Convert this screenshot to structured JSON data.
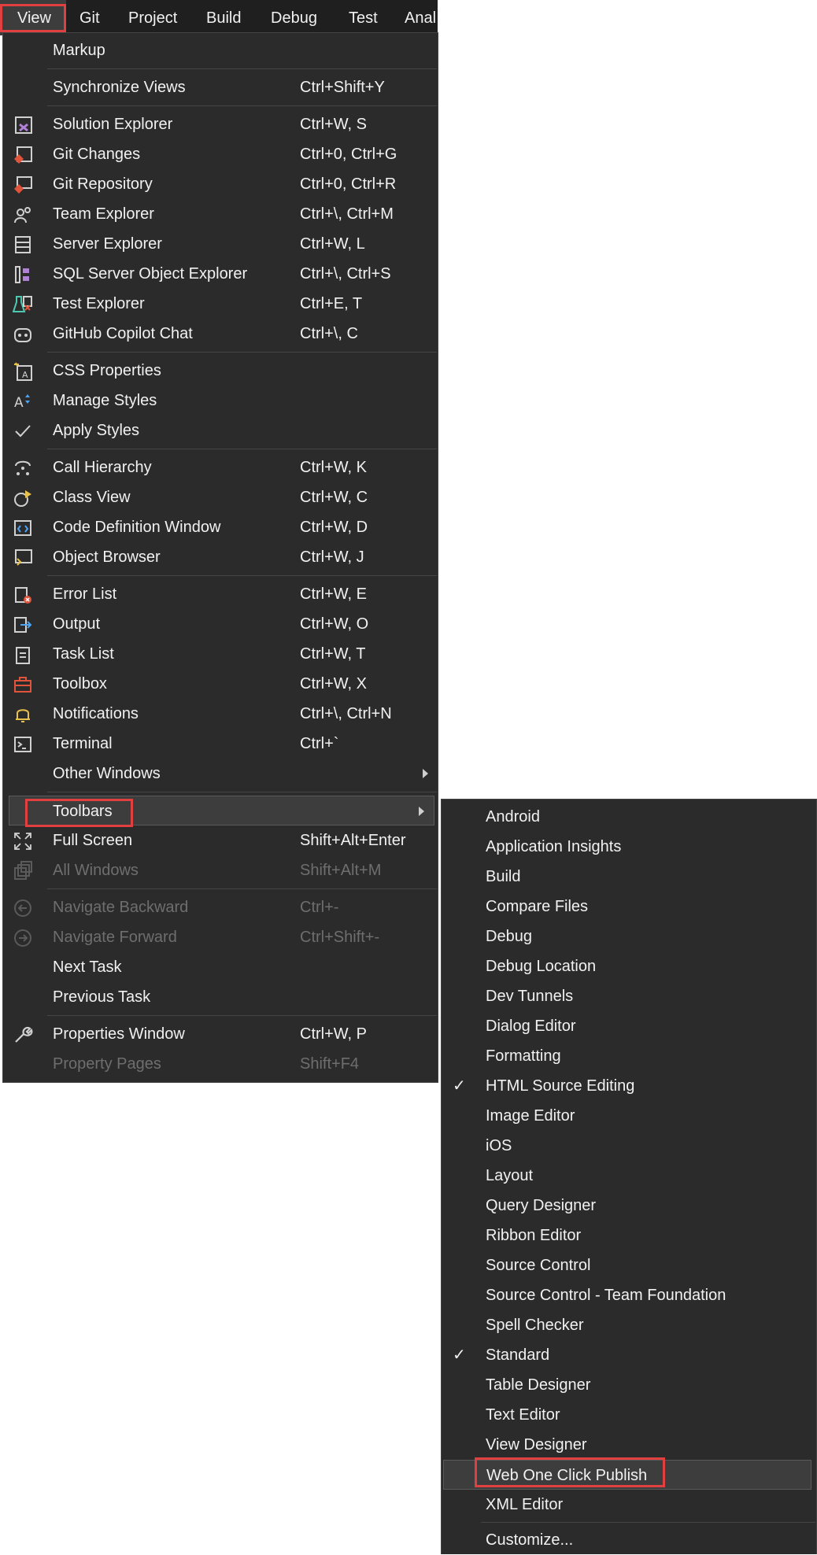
{
  "menubar": {
    "items": [
      {
        "label": "View"
      },
      {
        "label": "Git"
      },
      {
        "label": "Project"
      },
      {
        "label": "Build"
      },
      {
        "label": "Debug"
      },
      {
        "label": "Test"
      },
      {
        "label": "Anal"
      }
    ]
  },
  "view_menu": {
    "items": [
      {
        "label": "Markup",
        "shortcut": "",
        "icon": "none"
      },
      {
        "label": "Synchronize Views",
        "shortcut": "Ctrl+Shift+Y",
        "icon": "none"
      },
      {
        "label": "Solution Explorer",
        "shortcut": "Ctrl+W, S",
        "icon": "solution-explorer-icon"
      },
      {
        "label": "Git Changes",
        "shortcut": "Ctrl+0, Ctrl+G",
        "icon": "git-changes-icon"
      },
      {
        "label": "Git Repository",
        "shortcut": "Ctrl+0, Ctrl+R",
        "icon": "git-repository-icon"
      },
      {
        "label": "Team Explorer",
        "shortcut": "Ctrl+\\, Ctrl+M",
        "icon": "team-explorer-icon"
      },
      {
        "label": "Server Explorer",
        "shortcut": "Ctrl+W, L",
        "icon": "server-explorer-icon"
      },
      {
        "label": "SQL Server Object Explorer",
        "shortcut": "Ctrl+\\, Ctrl+S",
        "icon": "sql-server-icon"
      },
      {
        "label": "Test Explorer",
        "shortcut": "Ctrl+E, T",
        "icon": "test-explorer-icon"
      },
      {
        "label": "GitHub Copilot Chat",
        "shortcut": "Ctrl+\\, C",
        "icon": "copilot-icon"
      },
      {
        "label": "CSS Properties",
        "shortcut": "",
        "icon": "css-properties-icon"
      },
      {
        "label": "Manage Styles",
        "shortcut": "",
        "icon": "manage-styles-icon"
      },
      {
        "label": "Apply Styles",
        "shortcut": "",
        "icon": "checkmark-icon"
      },
      {
        "label": "Call Hierarchy",
        "shortcut": "Ctrl+W, K",
        "icon": "call-hierarchy-icon"
      },
      {
        "label": "Class View",
        "shortcut": "Ctrl+W, C",
        "icon": "class-view-icon"
      },
      {
        "label": "Code Definition Window",
        "shortcut": "Ctrl+W, D",
        "icon": "code-definition-icon"
      },
      {
        "label": "Object Browser",
        "shortcut": "Ctrl+W, J",
        "icon": "object-browser-icon"
      },
      {
        "label": "Error List",
        "shortcut": "Ctrl+W, E",
        "icon": "error-list-icon"
      },
      {
        "label": "Output",
        "shortcut": "Ctrl+W, O",
        "icon": "output-icon"
      },
      {
        "label": "Task List",
        "shortcut": "Ctrl+W, T",
        "icon": "task-list-icon"
      },
      {
        "label": "Toolbox",
        "shortcut": "Ctrl+W, X",
        "icon": "toolbox-icon"
      },
      {
        "label": "Notifications",
        "shortcut": "Ctrl+\\, Ctrl+N",
        "icon": "bell-icon"
      },
      {
        "label": "Terminal",
        "shortcut": "Ctrl+`",
        "icon": "terminal-icon"
      },
      {
        "label": "Other Windows",
        "shortcut": "",
        "icon": "none"
      },
      {
        "label": "Toolbars",
        "shortcut": "",
        "icon": "none"
      },
      {
        "label": "Full Screen",
        "shortcut": "Shift+Alt+Enter",
        "icon": "full-screen-icon"
      },
      {
        "label": "All Windows",
        "shortcut": "Shift+Alt+M",
        "icon": "all-windows-icon"
      },
      {
        "label": "Navigate Backward",
        "shortcut": "Ctrl+-",
        "icon": "navigate-backward-icon"
      },
      {
        "label": "Navigate Forward",
        "shortcut": "Ctrl+Shift+-",
        "icon": "navigate-forward-icon"
      },
      {
        "label": "Next Task",
        "shortcut": "",
        "icon": "none"
      },
      {
        "label": "Previous Task",
        "shortcut": "",
        "icon": "none"
      },
      {
        "label": "Properties Window",
        "shortcut": "Ctrl+W, P",
        "icon": "wrench-icon"
      },
      {
        "label": "Property Pages",
        "shortcut": "Shift+F4",
        "icon": "none"
      }
    ]
  },
  "toolbars_menu": {
    "items": [
      {
        "label": "Android",
        "checked": false
      },
      {
        "label": "Application Insights",
        "checked": false
      },
      {
        "label": "Build",
        "checked": false
      },
      {
        "label": "Compare Files",
        "checked": false
      },
      {
        "label": "Debug",
        "checked": false
      },
      {
        "label": "Debug Location",
        "checked": false
      },
      {
        "label": "Dev Tunnels",
        "checked": false
      },
      {
        "label": "Dialog Editor",
        "checked": false
      },
      {
        "label": "Formatting",
        "checked": false
      },
      {
        "label": "HTML Source Editing",
        "checked": true
      },
      {
        "label": "Image Editor",
        "checked": false
      },
      {
        "label": "iOS",
        "checked": false
      },
      {
        "label": "Layout",
        "checked": false
      },
      {
        "label": "Query Designer",
        "checked": false
      },
      {
        "label": "Ribbon Editor",
        "checked": false
      },
      {
        "label": "Source Control",
        "checked": false
      },
      {
        "label": "Source Control - Team Foundation",
        "checked": false
      },
      {
        "label": "Spell Checker",
        "checked": false
      },
      {
        "label": "Standard",
        "checked": true
      },
      {
        "label": "Table Designer",
        "checked": false
      },
      {
        "label": "Text Editor",
        "checked": false
      },
      {
        "label": "View Designer",
        "checked": false
      },
      {
        "label": "Web One Click Publish",
        "checked": false
      },
      {
        "label": "XML Editor",
        "checked": false
      },
      {
        "label": "Customize...",
        "checked": false
      }
    ],
    "checkmark": "✓"
  },
  "colors": {
    "menu_bg": "#2b2b2b",
    "menubar_bg": "#1f1f1f",
    "highlight_border": "#e0403f",
    "text": "#f1f1f1",
    "disabled_text": "#6e6e6e"
  }
}
